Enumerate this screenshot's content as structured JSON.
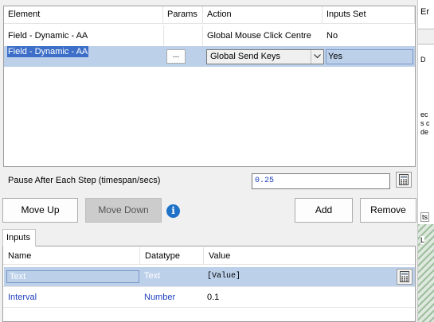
{
  "steps_grid": {
    "columns": [
      "Element",
      "Params",
      "Action",
      "Inputs Set"
    ],
    "rows": [
      {
        "element": "Field - Dynamic - AA",
        "params": "",
        "action": "Global Mouse Click Centre",
        "inputs_set": "No",
        "selected": false
      },
      {
        "element": "Field - Dynamic - AA",
        "params": "...",
        "action": "Global Send Keys",
        "inputs_set": "Yes",
        "selected": true
      }
    ]
  },
  "pause": {
    "label": "Pause After Each Step (timespan/secs)",
    "value": "0.25"
  },
  "buttons": {
    "move_up": "Move Up",
    "move_down": "Move Down",
    "info": "i",
    "add": "Add",
    "remove": "Remove"
  },
  "inputs": {
    "tab_label": "Inputs",
    "columns": [
      "Name",
      "Datatype",
      "Value"
    ],
    "rows": [
      {
        "name": "Text",
        "datatype": "Text",
        "value": "[Value]",
        "selected": true
      },
      {
        "name": "Interval",
        "datatype": "Number",
        "value": "0.1",
        "selected": false
      }
    ]
  },
  "right_panel": {
    "fragments": [
      "Er",
      "D",
      "ec",
      "s c",
      "de",
      "ts",
      "L"
    ]
  },
  "icons": {
    "calculator": "calculator-icon",
    "dropdown": "chevron-down-icon",
    "info": "info-icon"
  },
  "colors": {
    "selection": "#bcd0ea",
    "highlight": "#3d6fc8",
    "value_blue": "#1f3fbf",
    "info_blue": "#1e72c8"
  }
}
